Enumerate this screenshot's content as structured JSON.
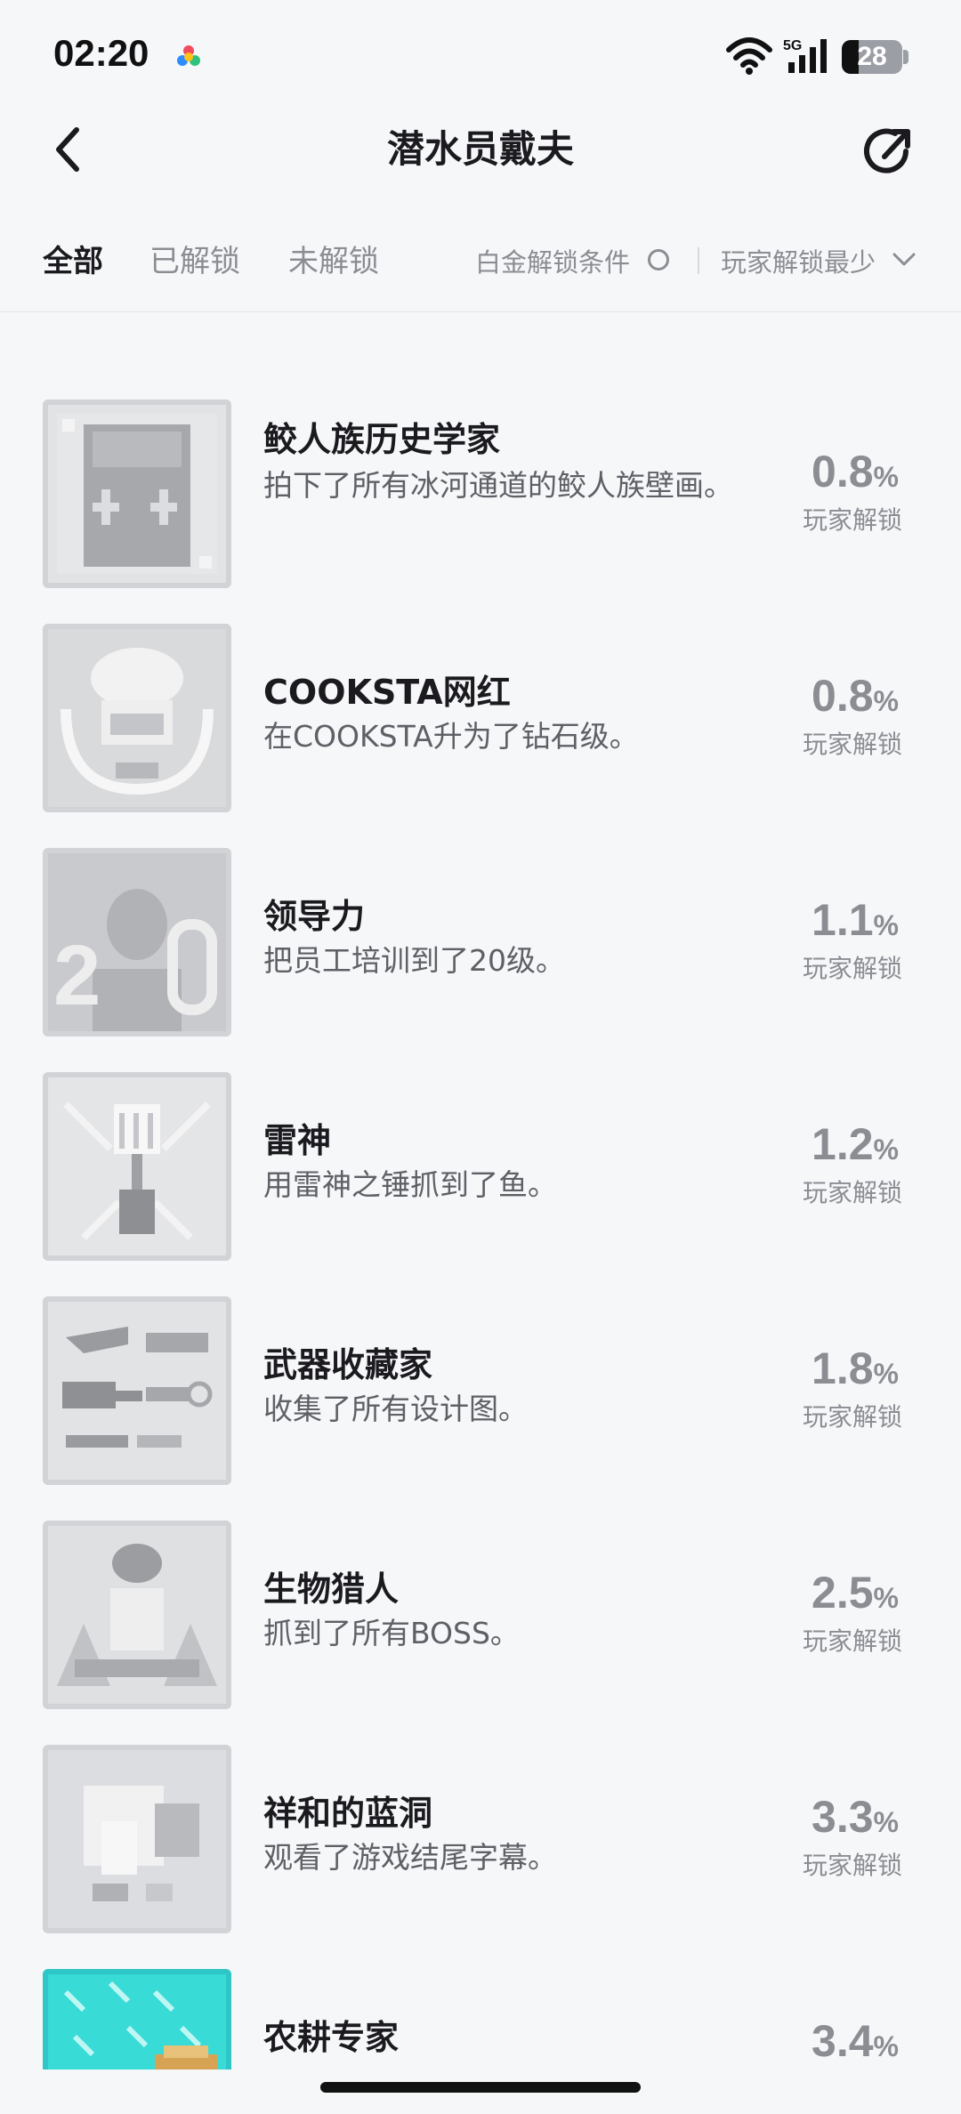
{
  "status_bar": {
    "time": "02:20",
    "network": "5G",
    "battery": "28",
    "battery_level_percent": 28
  },
  "header": {
    "title": "潜水员戴夫",
    "back_icon": "chevron-left-icon",
    "share_icon": "share-arrow-icon"
  },
  "tabs": [
    {
      "label": "全部",
      "active": true
    },
    {
      "label": "已解锁",
      "active": false
    },
    {
      "label": "未解锁",
      "active": false
    }
  ],
  "filters": {
    "platinum_label": "白金解锁条件",
    "sort_label": "玩家解锁最少"
  },
  "achievements": [
    {
      "name": "鲛人族历史学家",
      "description": "拍下了所有冰河通道的鲛人族壁画。",
      "percent": "0.8",
      "unit": "%",
      "caption": "玩家解锁"
    },
    {
      "name": "COOKSTA网红",
      "description": "在COOKSTA升为了钻石级。",
      "percent": "0.8",
      "unit": "%",
      "caption": "玩家解锁"
    },
    {
      "name": "领导力",
      "description": "把员工培训到了20级。",
      "percent": "1.1",
      "unit": "%",
      "caption": "玩家解锁"
    },
    {
      "name": "雷神",
      "description": "用雷神之锤抓到了鱼。",
      "percent": "1.2",
      "unit": "%",
      "caption": "玩家解锁"
    },
    {
      "name": "武器收藏家",
      "description": "收集了所有设计图。",
      "percent": "1.8",
      "unit": "%",
      "caption": "玩家解锁"
    },
    {
      "name": "生物猎人",
      "description": "抓到了所有BOSS。",
      "percent": "2.5",
      "unit": "%",
      "caption": "玩家解锁"
    },
    {
      "name": "祥和的蓝洞",
      "description": "观看了游戏结尾字幕。",
      "percent": "3.3",
      "unit": "%",
      "caption": "玩家解锁"
    },
    {
      "name": "农耕专家",
      "description": "",
      "percent": "3.4",
      "unit": "%",
      "caption": ""
    }
  ]
}
